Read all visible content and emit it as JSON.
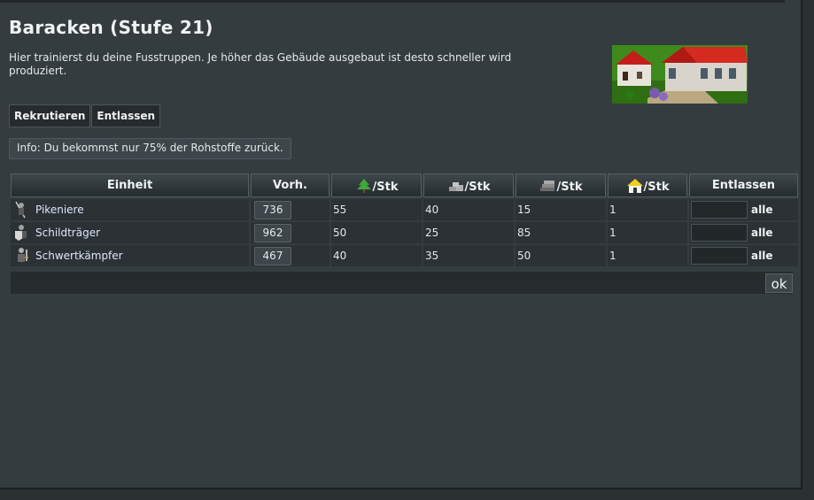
{
  "page": {
    "title": "Baracken (Stufe 21)",
    "description": "Hier trainierst du deine Fusstruppen. Je höher das Gebäude ausgebaut ist desto schneller wird produziert."
  },
  "tabs": [
    "Rekrutieren",
    "Entlassen"
  ],
  "info": "Info: Du bekommst nur 75% der Rohstoffe zurück.",
  "table": {
    "headers": {
      "unit": "Einheit",
      "available": "Vorh.",
      "wood": "/Stk",
      "stone": "/Stk",
      "iron": "/Stk",
      "population": "/Stk",
      "dismiss": "Entlassen"
    },
    "rows": [
      {
        "name": "Pikeniere",
        "count": "736",
        "wood": "55",
        "stone": "40",
        "iron": "15",
        "pop": "1",
        "all": "alle"
      },
      {
        "name": "Schildträger",
        "count": "962",
        "wood": "50",
        "stone": "25",
        "iron": "85",
        "pop": "1",
        "all": "alle"
      },
      {
        "name": "Schwertkämpfer",
        "count": "467",
        "wood": "40",
        "stone": "35",
        "iron": "50",
        "pop": "1",
        "all": "alle"
      }
    ]
  },
  "ok_button": "ok",
  "icons": {
    "wood": "tree-icon",
    "stone": "stone-icon",
    "iron": "iron-icon",
    "population": "house-icon"
  }
}
